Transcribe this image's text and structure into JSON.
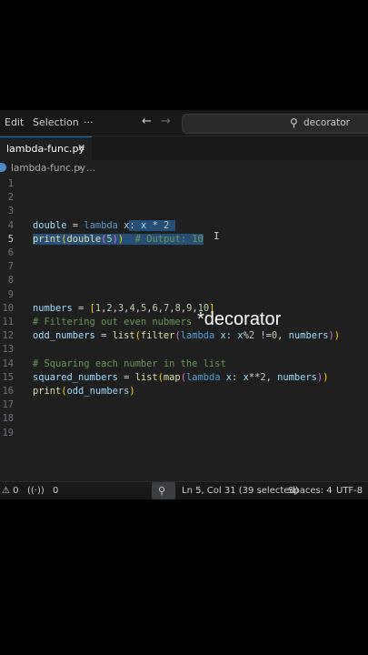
{
  "menu": {
    "edit": "Edit",
    "selection": "Selection",
    "more": "···"
  },
  "nav": {
    "back": "←",
    "forward": "→"
  },
  "search": {
    "icon": "search-icon",
    "text": "decorator"
  },
  "tab": {
    "label": "lambda-func.py",
    "close": "✕"
  },
  "breadcrumb": {
    "file": "lambda-func.py",
    "separator": "›",
    "more": "..."
  },
  "editor": {
    "line_numbers": [
      "1",
      "2",
      "3",
      "4",
      "5",
      "6",
      "7",
      "8",
      "9",
      "10",
      "11",
      "12",
      "13",
      "14",
      "15",
      "16",
      "17",
      "18",
      "19"
    ],
    "active_line": 5
  },
  "status": {
    "errors": "⚠ 0",
    "ports": "0",
    "position": "Ln 5, Col 31 (39 selected)",
    "spaces": "Spaces: 4",
    "encoding": "UTF-8"
  },
  "overlay": {
    "caption": "*decorator"
  }
}
